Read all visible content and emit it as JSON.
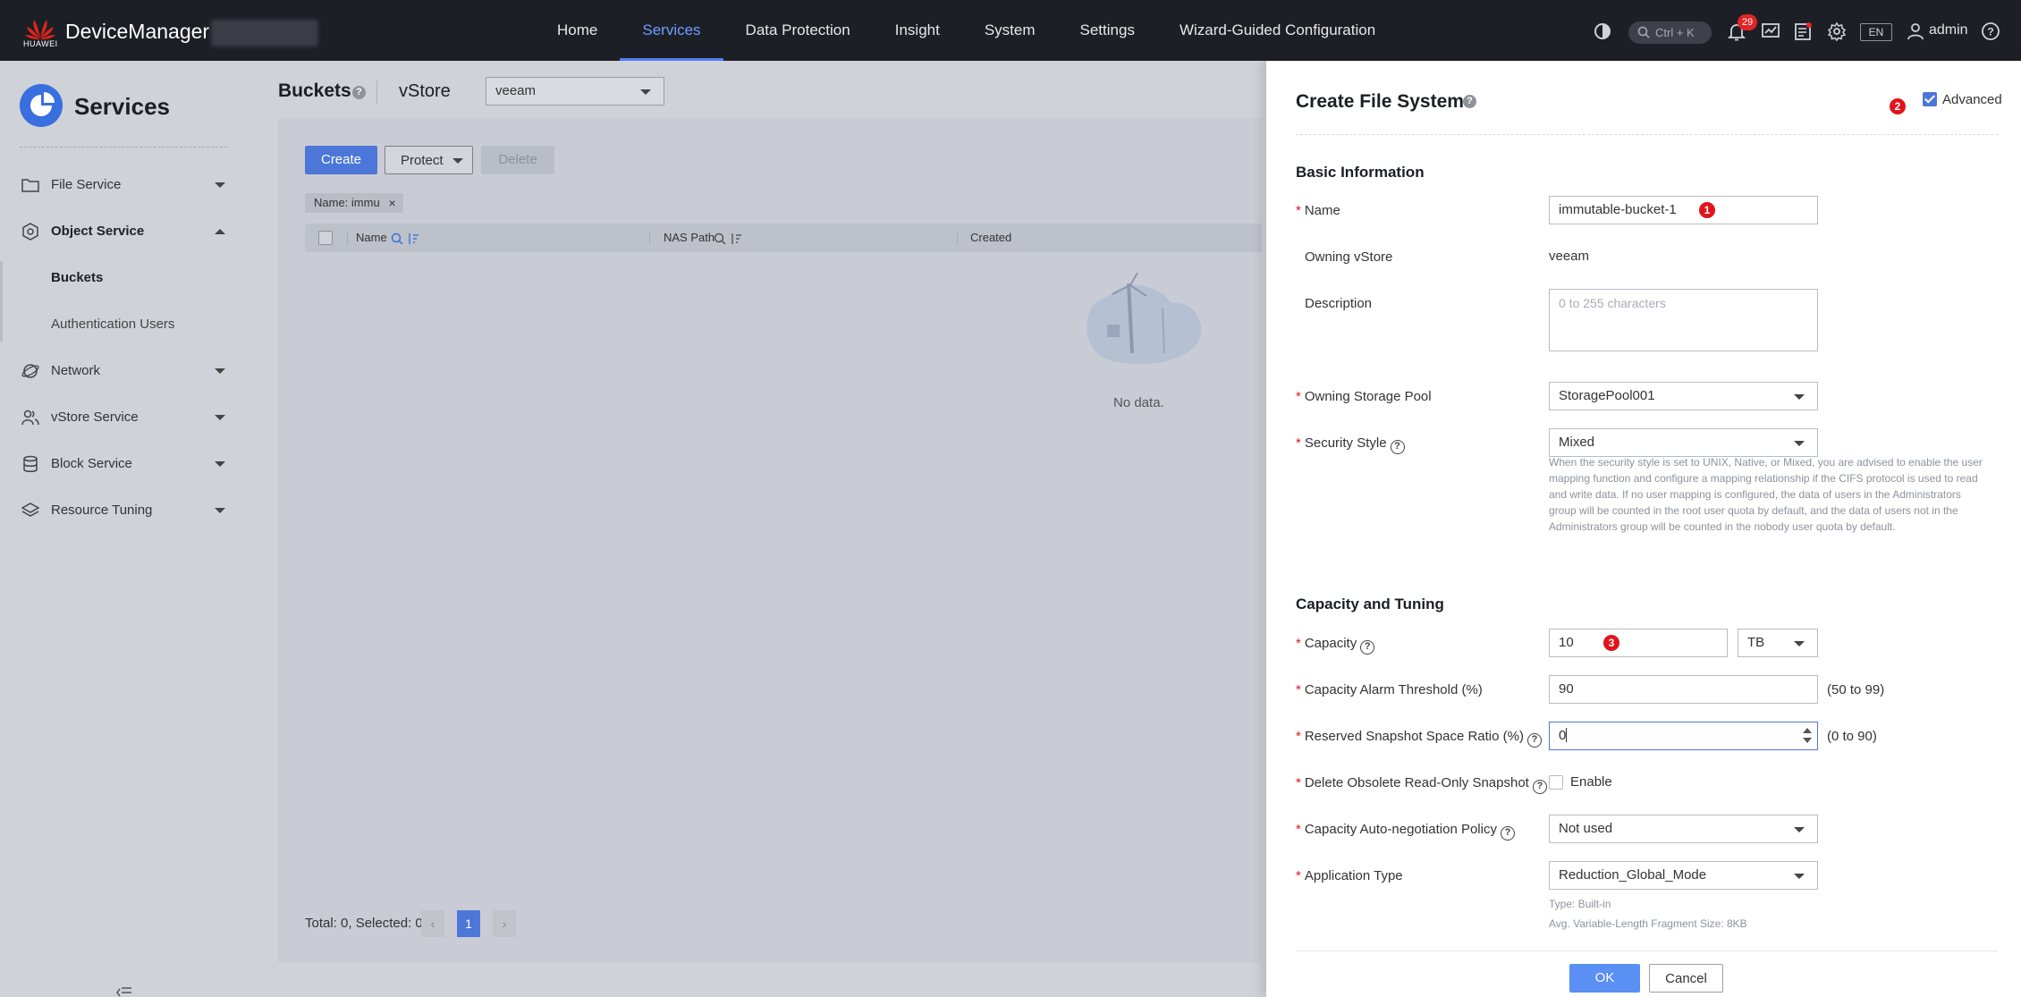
{
  "topbar": {
    "brand": "HUAWEI",
    "app_name": "DeviceManager",
    "nav": [
      {
        "label": "Home"
      },
      {
        "label": "Services"
      },
      {
        "label": "Data Protection"
      },
      {
        "label": "Insight"
      },
      {
        "label": "System"
      },
      {
        "label": "Settings"
      },
      {
        "label": "Wizard-Guided Configuration"
      }
    ],
    "active_nav": "Services",
    "search_shortcut": "Ctrl + K",
    "notification_count": "29",
    "language": "EN",
    "user": "admin",
    "icons": [
      "theme-icon",
      "search-icon",
      "bell-icon",
      "monitor-icon",
      "task-icon",
      "gear-icon",
      "user-icon",
      "help-icon"
    ],
    "accent_color": "#4f7ef0"
  },
  "sidebar": {
    "title": "Services",
    "items": [
      {
        "label": "File Service",
        "icon": "folder-icon"
      },
      {
        "label": "Object Service",
        "icon": "object-icon"
      },
      {
        "label": "Network",
        "icon": "network-icon"
      },
      {
        "label": "vStore Service",
        "icon": "users-icon"
      },
      {
        "label": "Block Service",
        "icon": "database-icon"
      },
      {
        "label": "Resource Tuning",
        "icon": "layers-icon"
      }
    ],
    "object_sub": [
      {
        "label": "Buckets"
      },
      {
        "label": "Authentication Users"
      }
    ]
  },
  "main": {
    "title": "Buckets",
    "vstore_label": "vStore",
    "vstore_value": "veeam",
    "buttons": {
      "create": "Create",
      "protect": "Protect",
      "delete": "Delete"
    },
    "filter_chip": "Name: immu",
    "columns": [
      "Name",
      "NAS Path",
      "Created"
    ],
    "empty_text": "No data.",
    "footer_total": "Total: 0, Selected: 0",
    "current_page": "1"
  },
  "drawer": {
    "title": "Create File System",
    "advanced_label": "Advanced",
    "advanced_checked": true,
    "markers": [
      "1",
      "2",
      "3"
    ],
    "basic_title": "Basic Information",
    "name_label": "Name",
    "name_value": "immutable-bucket-1",
    "owning_vstore_label": "Owning vStore",
    "owning_vstore_value": "veeam",
    "description_label": "Description",
    "description_placeholder": "0 to 255 characters",
    "pool_label": "Owning Storage Pool",
    "pool_value": "StoragePool001",
    "security_label": "Security Style",
    "security_value": "Mixed",
    "security_hint": "When the security style is set to UNIX, Native, or Mixed, you are advised to enable the user mapping function and configure a mapping relationship if the CIFS protocol is used to read and write data. If no user mapping is configured, the data of users in the Administrators group will be counted in the root user quota by default, and the data of users not in the Administrators group will be counted in the nobody user quota by default.",
    "capacity_title": "Capacity and Tuning",
    "capacity_label": "Capacity",
    "capacity_value": "10",
    "capacity_unit": "TB",
    "alarm_label": "Capacity Alarm Threshold (%)",
    "alarm_value": "90",
    "alarm_range": "(50 to 99)",
    "snapshot_label": "Reserved Snapshot Space Ratio (%)",
    "snapshot_value": "0",
    "snapshot_range": "(0 to 90)",
    "obsolete_label": "Delete Obsolete Read-Only Snapshot",
    "obsolete_enable": "Enable",
    "autoneg_label": "Capacity Auto-negotiation Policy",
    "autoneg_value": "Not used",
    "apptype_label": "Application Type",
    "apptype_value": "Reduction_Global_Mode",
    "apptype_hint1": "Type: Built-in",
    "apptype_hint2": "Avg. Variable-Length Fragment Size: 8KB",
    "ok": "OK",
    "cancel": "Cancel",
    "ok_color": "#5a8ff3",
    "marker_color": "#e0151b"
  }
}
